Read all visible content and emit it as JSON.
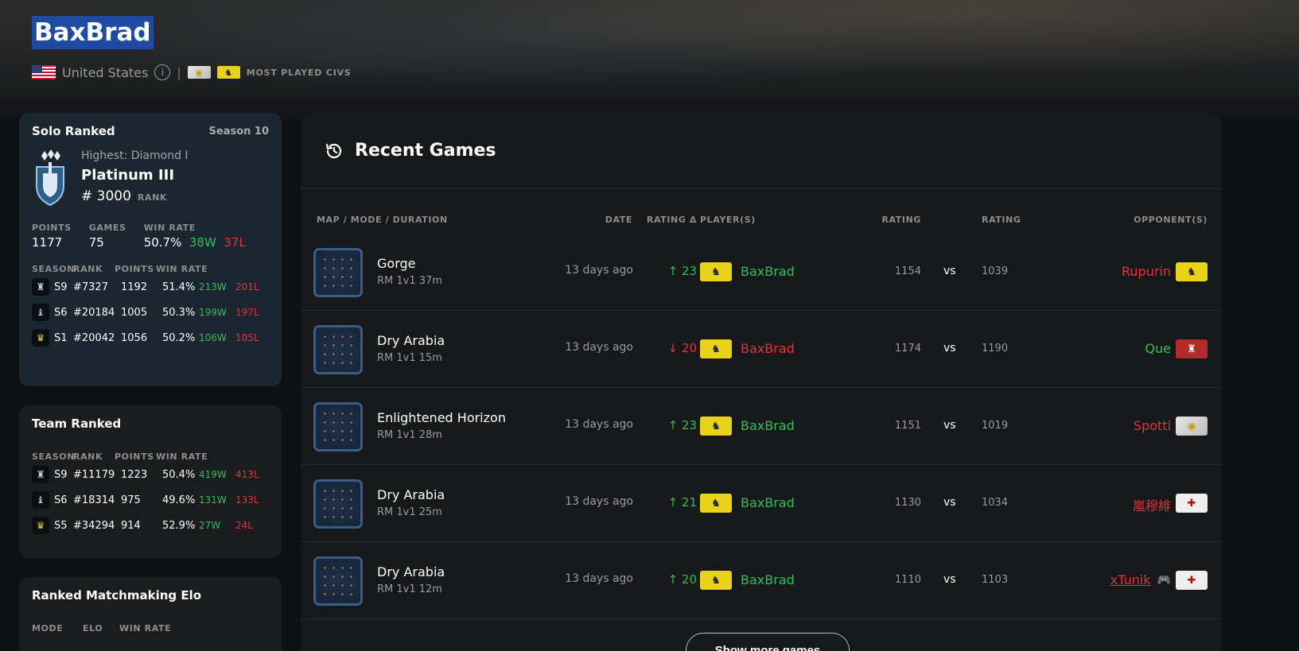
{
  "profile": {
    "name": "BaxBrad",
    "country": "United States",
    "most_played_label": "MOST PLAYED CIVS",
    "separator": "|"
  },
  "solo": {
    "title": "Solo Ranked",
    "season": "Season 10",
    "highest": "Highest: Diamond I",
    "tier": "Platinum III",
    "rank_num": "# 3000",
    "rank_label": "RANK",
    "stats": {
      "points_label": "POINTS",
      "points": "1177",
      "games_label": "GAMES",
      "games": "75",
      "winrate_label": "WIN RATE",
      "winrate": "50.7%",
      "wins": "38W",
      "losses": "37L"
    },
    "cols": [
      "SEASON",
      "RANK",
      "POINTS",
      "WIN RATE"
    ],
    "history": [
      {
        "season": "S9",
        "rank": "#7327",
        "points": "1192",
        "winrate": "51.4%",
        "wins": "213W",
        "losses": "201L"
      },
      {
        "season": "S6",
        "rank": "#20184",
        "points": "1005",
        "winrate": "50.3%",
        "wins": "199W",
        "losses": "197L"
      },
      {
        "season": "S1",
        "rank": "#20042",
        "points": "1056",
        "winrate": "50.2%",
        "wins": "106W",
        "losses": "105L"
      }
    ]
  },
  "team": {
    "title": "Team Ranked",
    "cols": [
      "SEASON",
      "RANK",
      "POINTS",
      "WIN RATE"
    ],
    "history": [
      {
        "season": "S9",
        "rank": "#11179",
        "points": "1223",
        "winrate": "50.4%",
        "wins": "419W",
        "losses": "413L"
      },
      {
        "season": "S6",
        "rank": "#18314",
        "points": "975",
        "winrate": "49.6%",
        "wins": "131W",
        "losses": "133L"
      },
      {
        "season": "S5",
        "rank": "#34294",
        "points": "914",
        "winrate": "52.9%",
        "wins": "27W",
        "losses": "24L"
      }
    ]
  },
  "elo": {
    "title": "Ranked Matchmaking Elo",
    "cols": [
      "MODE",
      "ELO",
      "WIN RATE"
    ]
  },
  "recent": {
    "title": "Recent Games",
    "cols": {
      "map": "MAP / MODE / DURATION",
      "date": "DATE",
      "delta": "RATING Δ",
      "players": "PLAYER(S)",
      "rating1": "RATING",
      "rating2": "RATING",
      "opponents": "OPPONENT(S)"
    },
    "vs": "vs",
    "show_more": "Show more games",
    "games": [
      {
        "map": "Gorge",
        "mode": "RM 1v1  37m",
        "date": "13 days ago",
        "delta": "↑ 23",
        "result": "win",
        "player": "BaxBrad",
        "rating1": "1154",
        "rating2": "1039",
        "opponent": "Rupurin",
        "opp_civ": "yellow"
      },
      {
        "map": "Dry Arabia",
        "mode": "RM 1v1  15m",
        "date": "13 days ago",
        "delta": "↓ 20",
        "result": "loss",
        "player": "BaxBrad",
        "rating1": "1174",
        "rating2": "1190",
        "opponent": "Que",
        "opp_civ": "red"
      },
      {
        "map": "Enlightened Horizon",
        "mode": "RM 1v1  28m",
        "date": "13 days ago",
        "delta": "↑ 23",
        "result": "win",
        "player": "BaxBrad",
        "rating1": "1151",
        "rating2": "1019",
        "opponent": "Spotti",
        "opp_civ": "white"
      },
      {
        "map": "Dry Arabia",
        "mode": "RM 1v1  25m",
        "date": "13 days ago",
        "delta": "↑ 21",
        "result": "win",
        "player": "BaxBrad",
        "rating1": "1130",
        "rating2": "1034",
        "opponent": "嵐穆緋",
        "opp_civ": "cross"
      },
      {
        "map": "Dry Arabia",
        "mode": "RM 1v1  12m",
        "date": "13 days ago",
        "delta": "↑ 20",
        "result": "win",
        "player": "BaxBrad",
        "rating1": "1110",
        "rating2": "1103",
        "opponent": "xTunik",
        "opp_civ": "cross"
      }
    ]
  },
  "colors": {
    "win": "#2ebf5b",
    "loss": "#e0343a",
    "accent": "#1d4aa3"
  },
  "icons": {
    "history": "history-icon",
    "info": "info-icon",
    "controller": "controller-icon"
  }
}
